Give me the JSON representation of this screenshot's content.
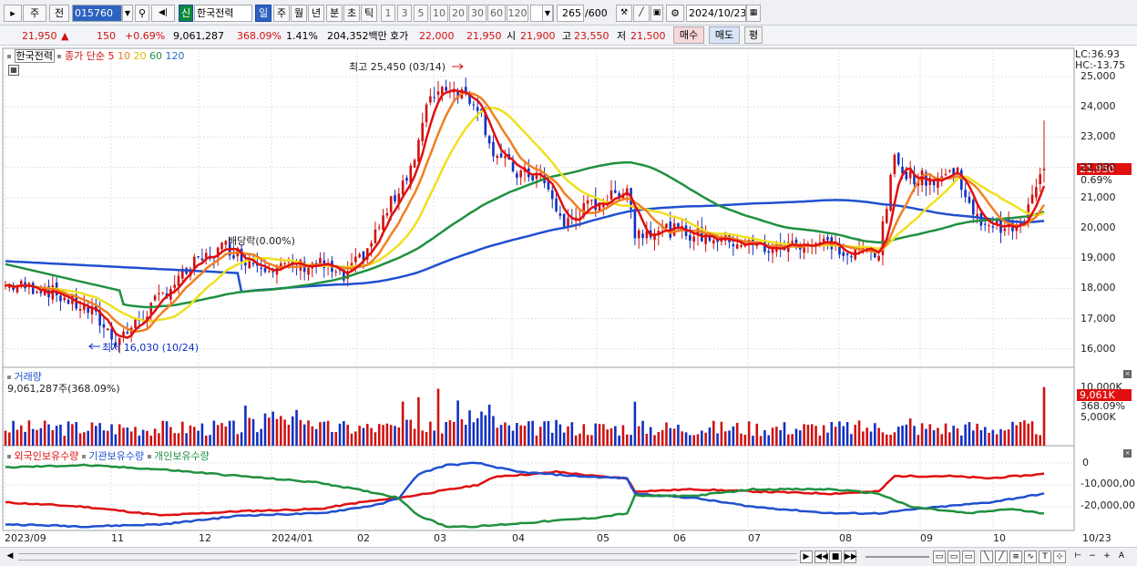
{
  "toolbar": {
    "type_sel": "주",
    "jeon": "전",
    "code": "015760",
    "stock_name": "한국전력",
    "sin": "신",
    "periods": [
      "일",
      "주",
      "월",
      "년",
      "분",
      "초",
      "틱"
    ],
    "minutes": [
      "1",
      "3",
      "5",
      "10",
      "20",
      "30",
      "60",
      "120"
    ],
    "count": "265",
    "count_total": "/600",
    "date": "2024/10/23"
  },
  "quote": {
    "price": "21,950",
    "arrow": "▲",
    "change": "150",
    "pct": "+0.69%",
    "volume": "9,061,287",
    "vol_pct": "368.09%",
    "turn": "1.41%",
    "amount": "204,352백만",
    "hoga_label": "호가",
    "hoga": "22,000",
    "hoga2": "21,950",
    "open_label": "시",
    "open": "21,900",
    "high_label": "고",
    "high": "23,550",
    "low_label": "저",
    "low": "21,500",
    "buy": "매수",
    "sell": "매도",
    "avg": "평"
  },
  "price_panel": {
    "stock": "한국전력",
    "ma_label": "종가 단순",
    "ma_periods": [
      "5",
      "10",
      "20",
      "60",
      "120"
    ],
    "lc": "LC:36.93",
    "hc": "HC:-13.75",
    "y_ticks": [
      "25,000",
      "24,000",
      "23,000",
      "22,000",
      "21,000",
      "20,000",
      "19,000",
      "18,000",
      "17,000",
      "16,000"
    ],
    "high_note": "최고 25,450 (03/14)",
    "low_note": "최저 16,030 (10/24)",
    "div_note": "배당락(0.00%)",
    "cur_tag": "21,950",
    "cur_pct": "0.69%"
  },
  "volume_panel": {
    "title": "거래량",
    "value": "9,061,287주(368.09%)",
    "y_ticks": [
      "10,000K",
      "5,000K"
    ],
    "tag": "9,061K",
    "tag_pct": "368.09%"
  },
  "holder_panel": {
    "legend": [
      "외국인보유수량",
      "기관보유수량",
      "개인보유수량"
    ],
    "y_ticks": [
      "0",
      "-10,000,00",
      "-20,000,00"
    ]
  },
  "x_axis": [
    "2023/09",
    "11",
    "12",
    "2024/01",
    "02",
    "03",
    "04",
    "05",
    "06",
    "07",
    "08",
    "09",
    "10",
    "10/23"
  ],
  "colors": {
    "up": "#d01010",
    "down": "#1030c0",
    "ma5": "#e01010",
    "ma10": "#f08020",
    "ma20": "#f0e020",
    "ma60": "#209040",
    "ma120": "#2050d0",
    "foreign": "#e01010",
    "inst": "#2050d0",
    "indiv": "#209040"
  }
}
